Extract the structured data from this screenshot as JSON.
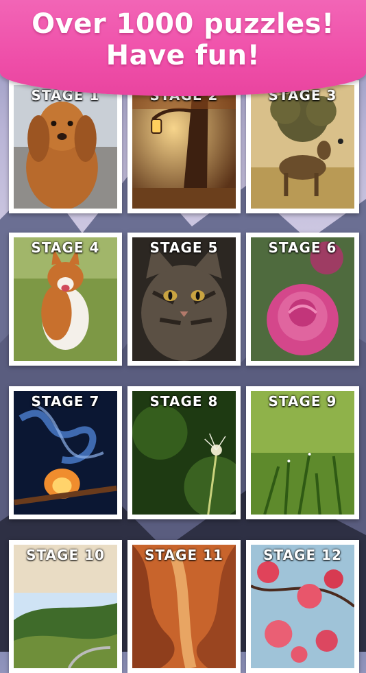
{
  "header": {
    "line1": "Over 1000 puzzles!",
    "line2": "Have fun!",
    "colors": {
      "banner": "#ef4fa9",
      "text": "#ffffff"
    }
  },
  "stages": [
    {
      "label": "STAGE 1",
      "image": "dog-spaniel"
    },
    {
      "label": "STAGE 2",
      "image": "lantern-tree"
    },
    {
      "label": "STAGE 3",
      "image": "deer-tree"
    },
    {
      "label": "STAGE 4",
      "image": "corgi"
    },
    {
      "label": "STAGE 5",
      "image": "tabby-cat"
    },
    {
      "label": "STAGE 6",
      "image": "pink-rose"
    },
    {
      "label": "STAGE 7",
      "image": "match-smoke"
    },
    {
      "label": "STAGE 8",
      "image": "dandelion"
    },
    {
      "label": "STAGE 9",
      "image": "grass-dew"
    },
    {
      "label": "STAGE 10",
      "image": "hills-road"
    },
    {
      "label": "STAGE 11",
      "image": "canyon"
    },
    {
      "label": "STAGE 12",
      "image": "pink-blossoms"
    }
  ]
}
